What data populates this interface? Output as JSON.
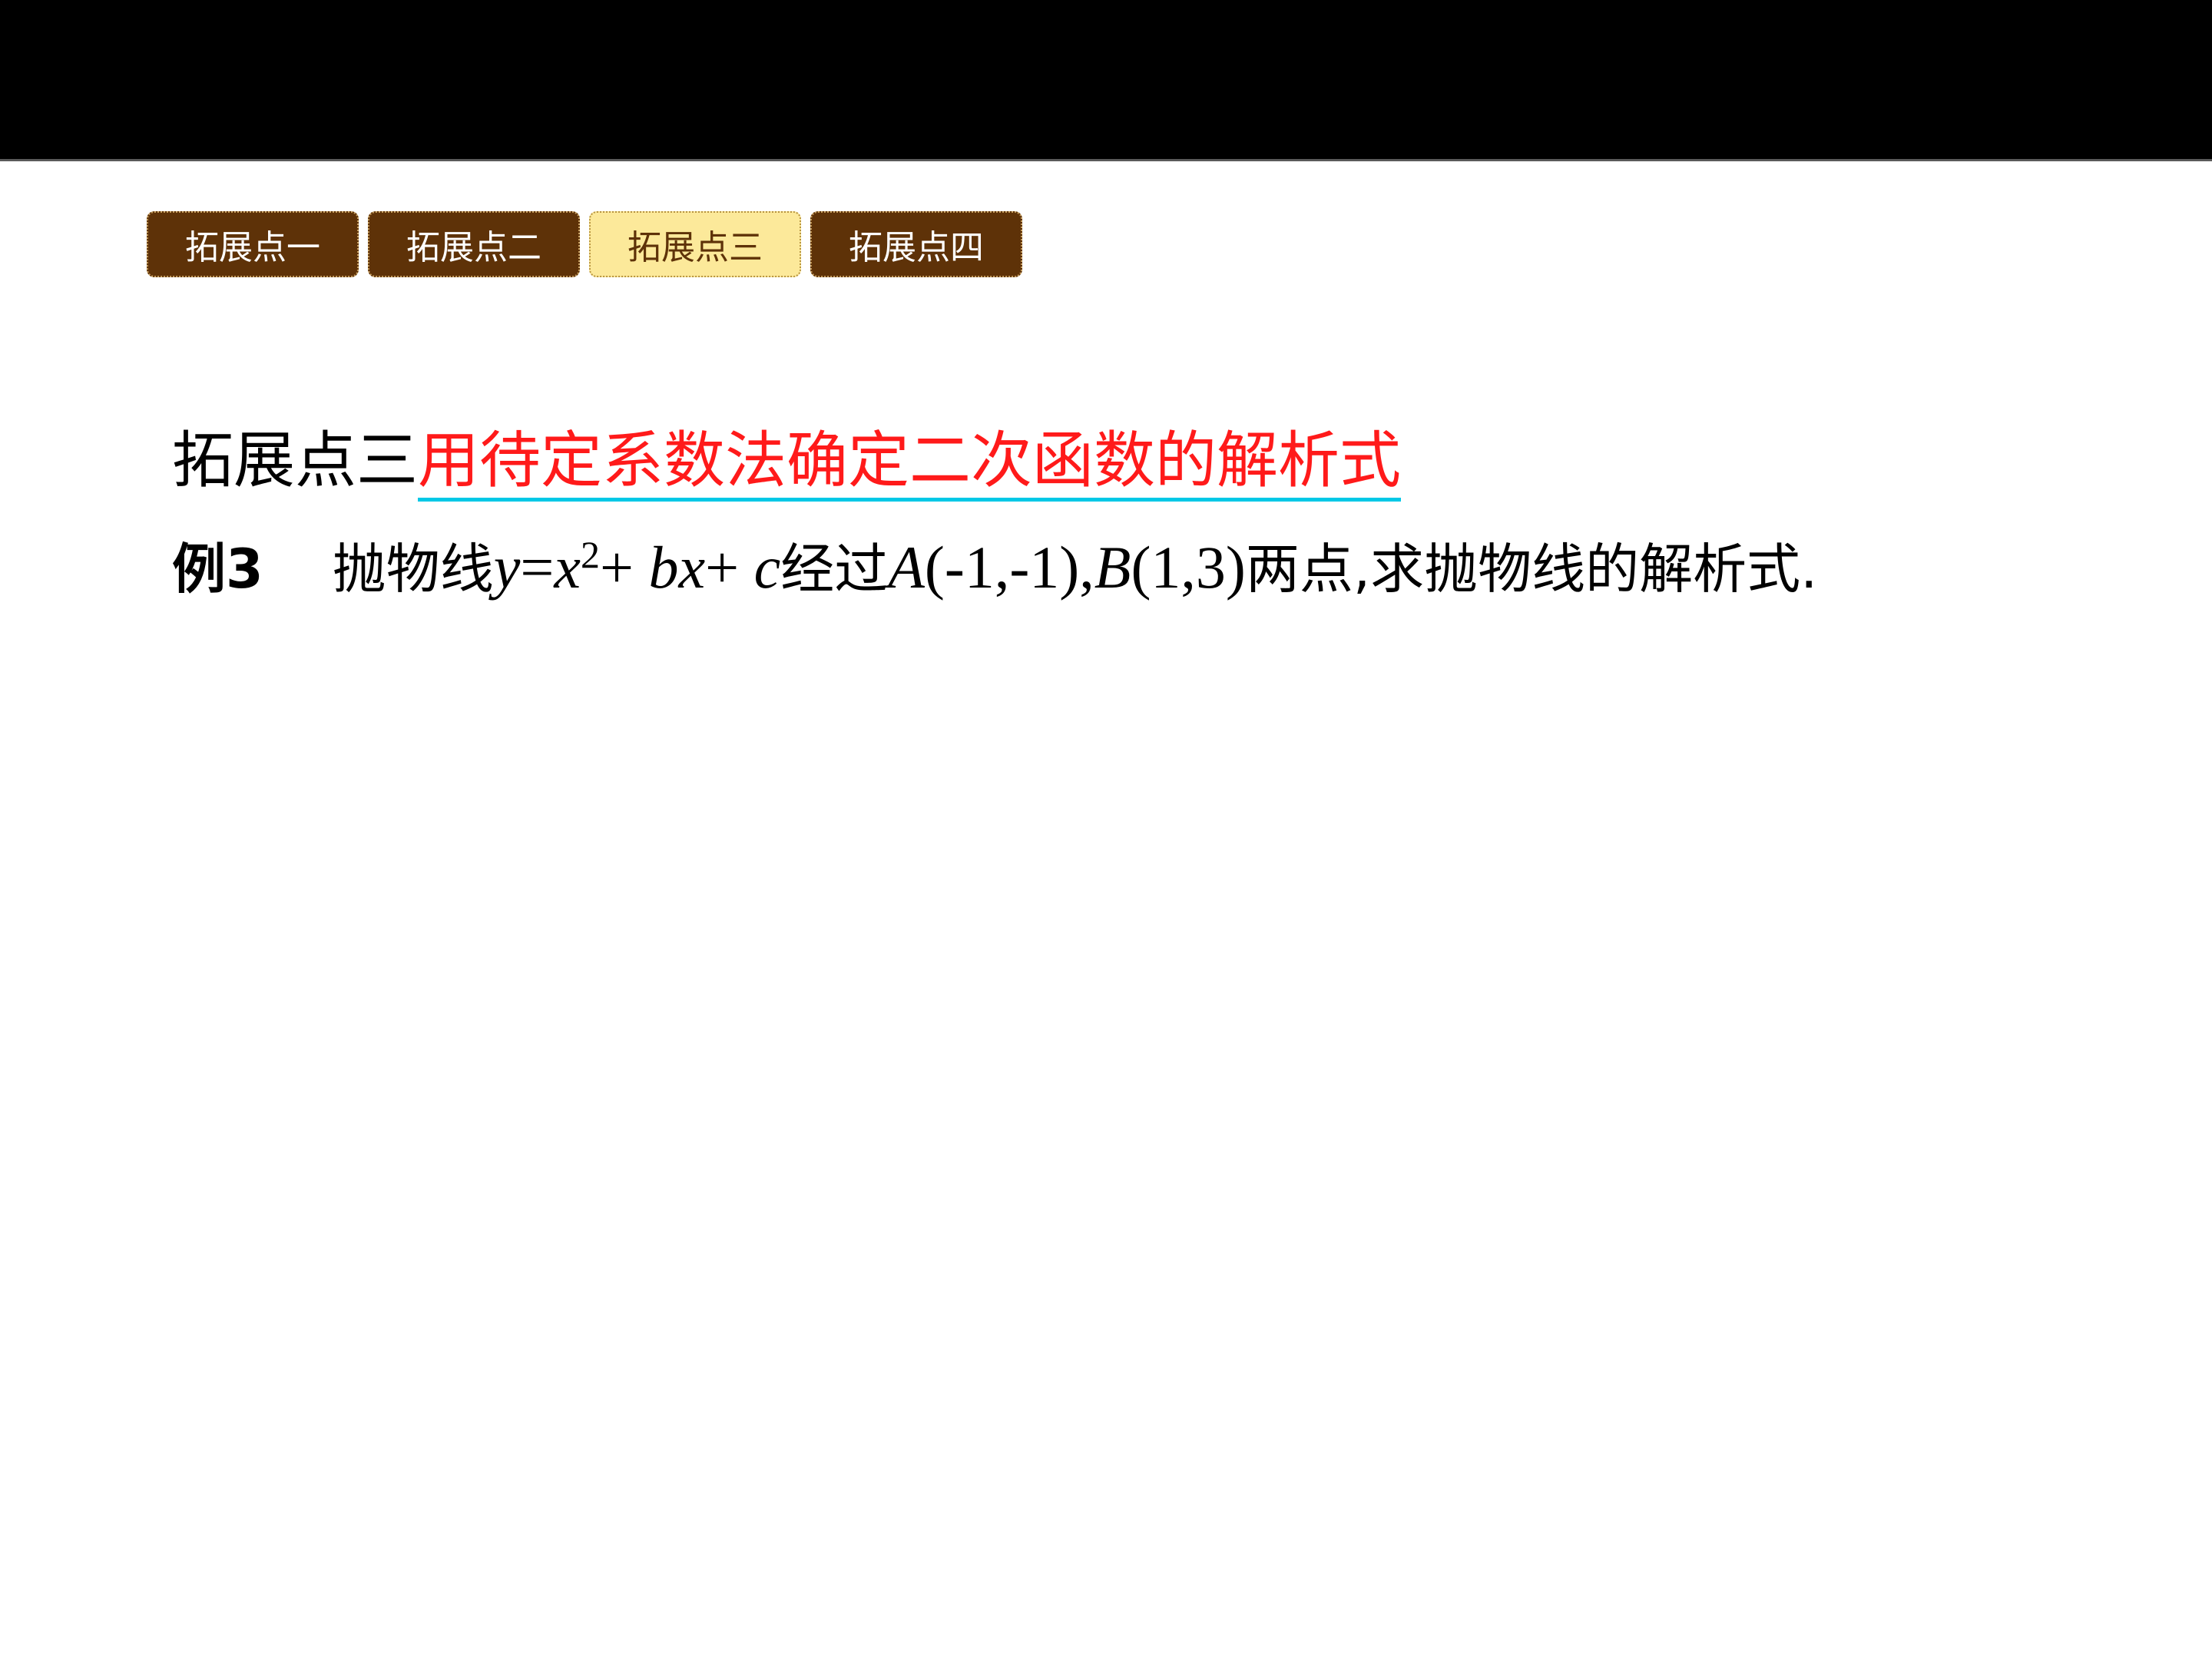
{
  "header_bar": {},
  "tabs": [
    {
      "label": "拓展点一",
      "active": false
    },
    {
      "label": "拓展点二",
      "active": false
    },
    {
      "label": "拓展点三",
      "active": true
    },
    {
      "label": "拓展点四",
      "active": false
    }
  ],
  "heading": {
    "prefix": "拓展点三",
    "topic": "用待定系数法确定二次函数的解析式"
  },
  "example": {
    "label": "例3",
    "text_1": "抛物线",
    "eq_y": "y",
    "eq_eq": "=",
    "eq_x": "x",
    "eq_exp": "2",
    "eq_plus1": "+ ",
    "eq_bx": "bx",
    "eq_plus2": "+ ",
    "eq_c": "c",
    "text_2": "经过",
    "point_a": "A",
    "point_a_coords": "(-1,-1),",
    "point_b": "B",
    "point_b_coords": "(1,3)",
    "text_3": "两点,求抛物线的解析式."
  },
  "colors": {
    "tab_dark": "#5e3208",
    "tab_active": "#fce99a",
    "topic_red": "#ff1a1a",
    "underline_cyan": "#00c8e6"
  }
}
